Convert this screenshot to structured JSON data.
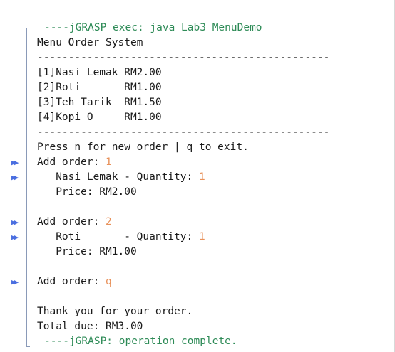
{
  "header": "----jGRASP exec: java Lab3_MenuDemo",
  "title": "Menu Order System",
  "divider": "-----------------------------------------------",
  "menu_items": [
    "[1]Nasi Lemak RM2.00",
    "[2]Roti       RM1.00",
    "[3]Teh Tarik  RM1.50",
    "[4]Kopi O     RM1.00"
  ],
  "instruction": "Press n for new order | q to exit.",
  "order1": {
    "prompt": "Add order: ",
    "input": "1",
    "qty_label": "   Nasi Lemak - Quantity: ",
    "qty_input": "1",
    "price": "   Price: RM2.00"
  },
  "order2": {
    "prompt": "Add order: ",
    "input": "2",
    "qty_label": "   Roti       - Quantity: ",
    "qty_input": "1",
    "price": "   Price: RM1.00"
  },
  "order3": {
    "prompt": "Add order: ",
    "input": "q"
  },
  "thanks": "Thank you for your order.",
  "total": "Total due: RM3.00",
  "footer": "----jGRASP: operation complete.",
  "gutter_icon": "input-arrow-icon",
  "gutter_glyph": "▶▶",
  "colors": {
    "jgrasp_green": "#2e8b57",
    "input_orange": "#e8915a",
    "arrow_blue": "#4a6ee0"
  }
}
